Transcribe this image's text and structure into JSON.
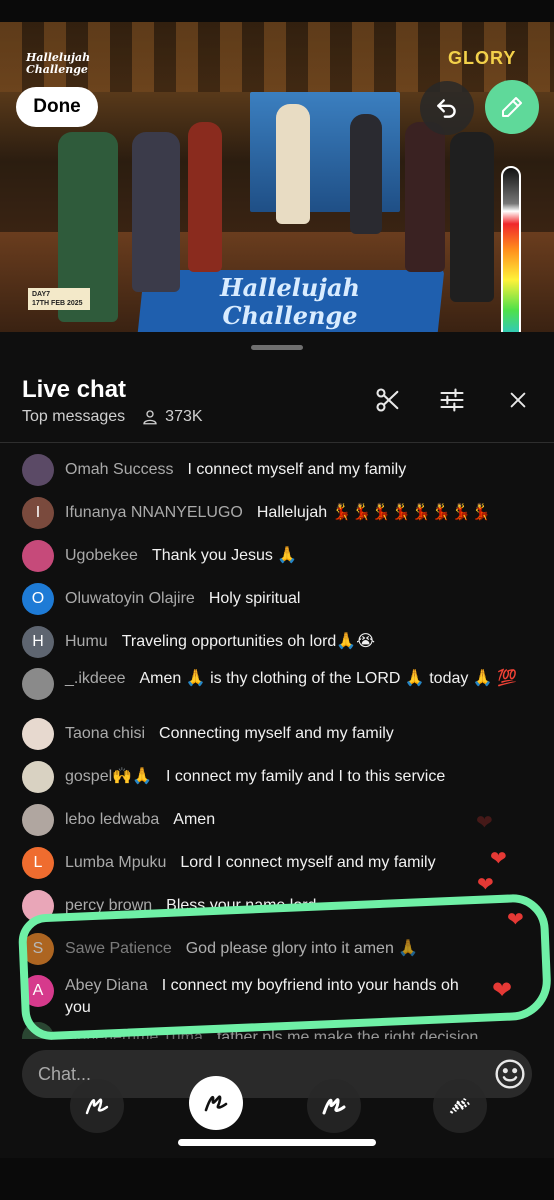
{
  "video": {
    "show_logo": "Hallelujah Challenge",
    "brand_logo": "GLORY",
    "rug_text": "Hallelujah Challenge",
    "day_tag": [
      "DAY7",
      "17TH FEB 2025"
    ]
  },
  "editor": {
    "done_label": "Done",
    "undo_icon": "undo-icon",
    "pen_icon": "pen-icon",
    "pen_color": "#5fd99a",
    "highlight_color": "#6ff0a6"
  },
  "chat": {
    "title": "Live chat",
    "filter": "Top messages",
    "viewers": "373K",
    "icons": [
      "scissors-icon",
      "sliders-icon",
      "close-icon"
    ],
    "messages": [
      {
        "author": "Omah Success",
        "text": "I connect myself and my family",
        "avatar_letter": "",
        "avatar_color": "#5b4a66"
      },
      {
        "author": "Ifunanya NNANYELUGO",
        "text": "Hallelujah 💃💃💃💃💃💃💃💃",
        "avatar_letter": "I",
        "avatar_color": "#7a4a3d"
      },
      {
        "author": "Ugobekee",
        "text": "Thank you Jesus 🙏",
        "avatar_letter": "",
        "avatar_color": "#c64a7a"
      },
      {
        "author": "Oluwatoyin Olajire",
        "text": "Holy spiritual",
        "avatar_letter": "O",
        "avatar_color": "#1e7bd6"
      },
      {
        "author": "Humu",
        "text": "Traveling opportunities oh lord🙏😭",
        "avatar_letter": "H",
        "avatar_color": "#5e6570"
      },
      {
        "author": "_.ikdeee",
        "text": "Amen 🙏 is thy clothing of the LORD 🙏 today 🙏 💯",
        "avatar_letter": "",
        "avatar_color": "#8a8a8a"
      },
      {
        "author": "Taona chisi",
        "text": "Connecting myself and my family",
        "avatar_letter": "",
        "avatar_color": "#e7d9cf"
      },
      {
        "author": "gospel🙌🙏",
        "text": "I connect my family and I to this service",
        "avatar_letter": "",
        "avatar_color": "#d9d2c2"
      },
      {
        "author": "lebo ledwaba",
        "text": "Amen",
        "avatar_letter": "",
        "avatar_color": "#b0a6a0"
      },
      {
        "author": "Lumba Mpuku",
        "text": "Lord I connect myself and my family",
        "avatar_letter": "L",
        "avatar_color": "#ef6c2f"
      },
      {
        "author": "percy brown",
        "text": "Bless your name lord",
        "avatar_letter": "",
        "avatar_color": "#e9a6b8"
      },
      {
        "author": "Sawe Patience",
        "text": "God please glory into it amen 🙏",
        "avatar_letter": "S",
        "avatar_color": "#f08a2a"
      },
      {
        "author": "Abey Diana",
        "text": "I connect my boyfriend into your hands oh you",
        "avatar_letter": "A",
        "avatar_color": "#d63a8c"
      },
      {
        "author": "Oghenerume Tuma",
        "text": "father pls me make the right decision",
        "avatar_letter": "",
        "avatar_color": "#3d6b4a"
      }
    ],
    "input_placeholder": "Chat...",
    "emoji_icon": "emoji-icon"
  },
  "brushes": [
    {
      "name": "pen-brush",
      "selected": false
    },
    {
      "name": "marker-brush",
      "selected": true
    },
    {
      "name": "neon-brush",
      "selected": false
    },
    {
      "name": "pattern-brush",
      "selected": false
    }
  ]
}
